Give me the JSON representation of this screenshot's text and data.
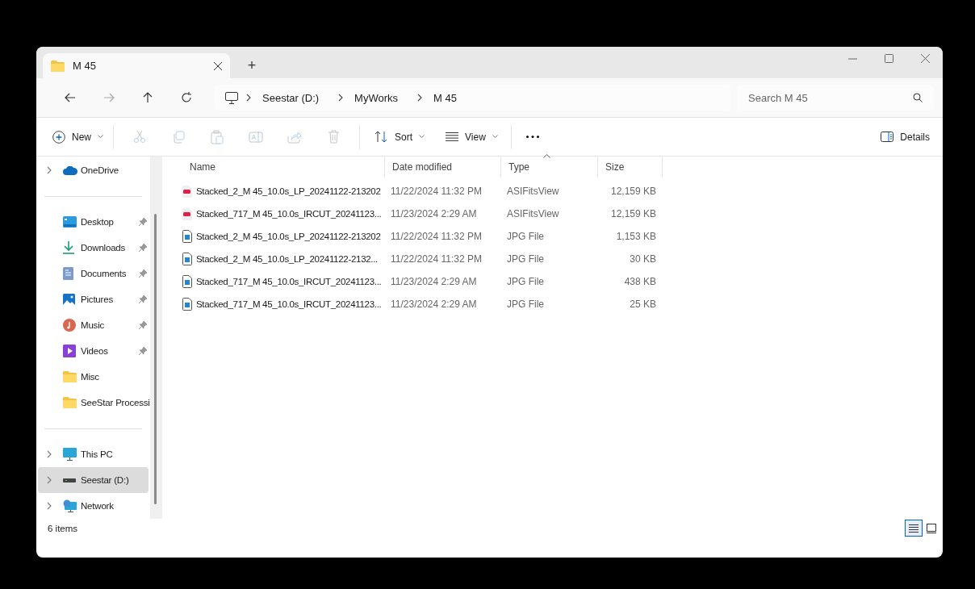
{
  "tabs": [
    {
      "title": "M 45",
      "selected": true
    }
  ],
  "new_tab": "+",
  "breadcrumb": [
    "Seestar (D:)",
    "MyWorks",
    "M 45"
  ],
  "search": {
    "placeholder": "Search M 45"
  },
  "toolbar": {
    "new": "New",
    "sort": "Sort",
    "view": "View",
    "details": "Details",
    "tools": [
      {
        "kind": "cut",
        "disabled": true
      },
      {
        "kind": "copy",
        "disabled": true
      },
      {
        "kind": "paste",
        "disabled": true
      },
      {
        "kind": "rename",
        "disabled": true
      },
      {
        "kind": "share",
        "disabled": true
      },
      {
        "kind": "delete",
        "disabled": true
      }
    ]
  },
  "sidebar": {
    "groups": [
      [
        {
          "label": "OneDrive",
          "kind": "cloud",
          "expandable": true,
          "pinned": false,
          "selected": false
        }
      ],
      [
        {
          "label": "Desktop",
          "kind": "desktop",
          "expandable": false,
          "pinned": true,
          "selected": false
        },
        {
          "label": "Downloads",
          "kind": "download",
          "expandable": false,
          "pinned": true,
          "selected": false
        },
        {
          "label": "Documents",
          "kind": "document",
          "expandable": false,
          "pinned": true,
          "selected": false
        },
        {
          "label": "Pictures",
          "kind": "picture",
          "expandable": false,
          "pinned": true,
          "selected": false
        },
        {
          "label": "Music",
          "kind": "music",
          "expandable": false,
          "pinned": true,
          "selected": false
        },
        {
          "label": "Videos",
          "kind": "video",
          "expandable": false,
          "pinned": true,
          "selected": false
        },
        {
          "label": "Misc",
          "kind": "folder",
          "expandable": false,
          "pinned": false,
          "selected": false
        },
        {
          "label": "SeeStar Processi",
          "kind": "folder",
          "expandable": false,
          "pinned": false,
          "selected": false
        }
      ],
      [
        {
          "label": "This PC",
          "kind": "pc",
          "expandable": true,
          "pinned": false,
          "selected": false
        },
        {
          "label": "Seestar (D:)",
          "kind": "drive",
          "expandable": true,
          "pinned": false,
          "selected": true
        },
        {
          "label": "Network",
          "kind": "network",
          "expandable": true,
          "pinned": false,
          "selected": false
        }
      ]
    ]
  },
  "table": {
    "columns": [
      {
        "label": "Name",
        "sorted": false
      },
      {
        "label": "Date modified",
        "sorted": false
      },
      {
        "label": "Type",
        "sorted": true
      },
      {
        "label": "Size",
        "sorted": false
      }
    ],
    "rows": [
      {
        "kind": "fits",
        "name": "Stacked_2_M 45_10.0s_LP_20241122-213202",
        "date": "11/22/2024 11:32 PM",
        "type": "ASIFitsView",
        "size": "12,159 KB"
      },
      {
        "kind": "fits",
        "name": "Stacked_717_M 45_10.0s_IRCUT_20241123...",
        "date": "11/23/2024 2:29 AM",
        "type": "ASIFitsView",
        "size": "12,159 KB"
      },
      {
        "kind": "jpg",
        "name": "Stacked_2_M 45_10.0s_LP_20241122-213202",
        "date": "11/22/2024 11:32 PM",
        "type": "JPG File",
        "size": "1,153 KB"
      },
      {
        "kind": "jpg",
        "name": "Stacked_2_M 45_10.0s_LP_20241122-2132...",
        "date": "11/22/2024 11:32 PM",
        "type": "JPG File",
        "size": "30 KB"
      },
      {
        "kind": "jpg",
        "name": "Stacked_717_M 45_10.0s_IRCUT_20241123...",
        "date": "11/23/2024 2:29 AM",
        "type": "JPG File",
        "size": "438 KB"
      },
      {
        "kind": "jpg",
        "name": "Stacked_717_M 45_10.0s_IRCUT_20241123...",
        "date": "11/23/2024 2:29 AM",
        "type": "JPG File",
        "size": "25 KB"
      }
    ]
  },
  "status": {
    "count": "6 items",
    "views": [
      {
        "kind": "details",
        "selected": true
      },
      {
        "kind": "tiles",
        "selected": false
      }
    ]
  }
}
